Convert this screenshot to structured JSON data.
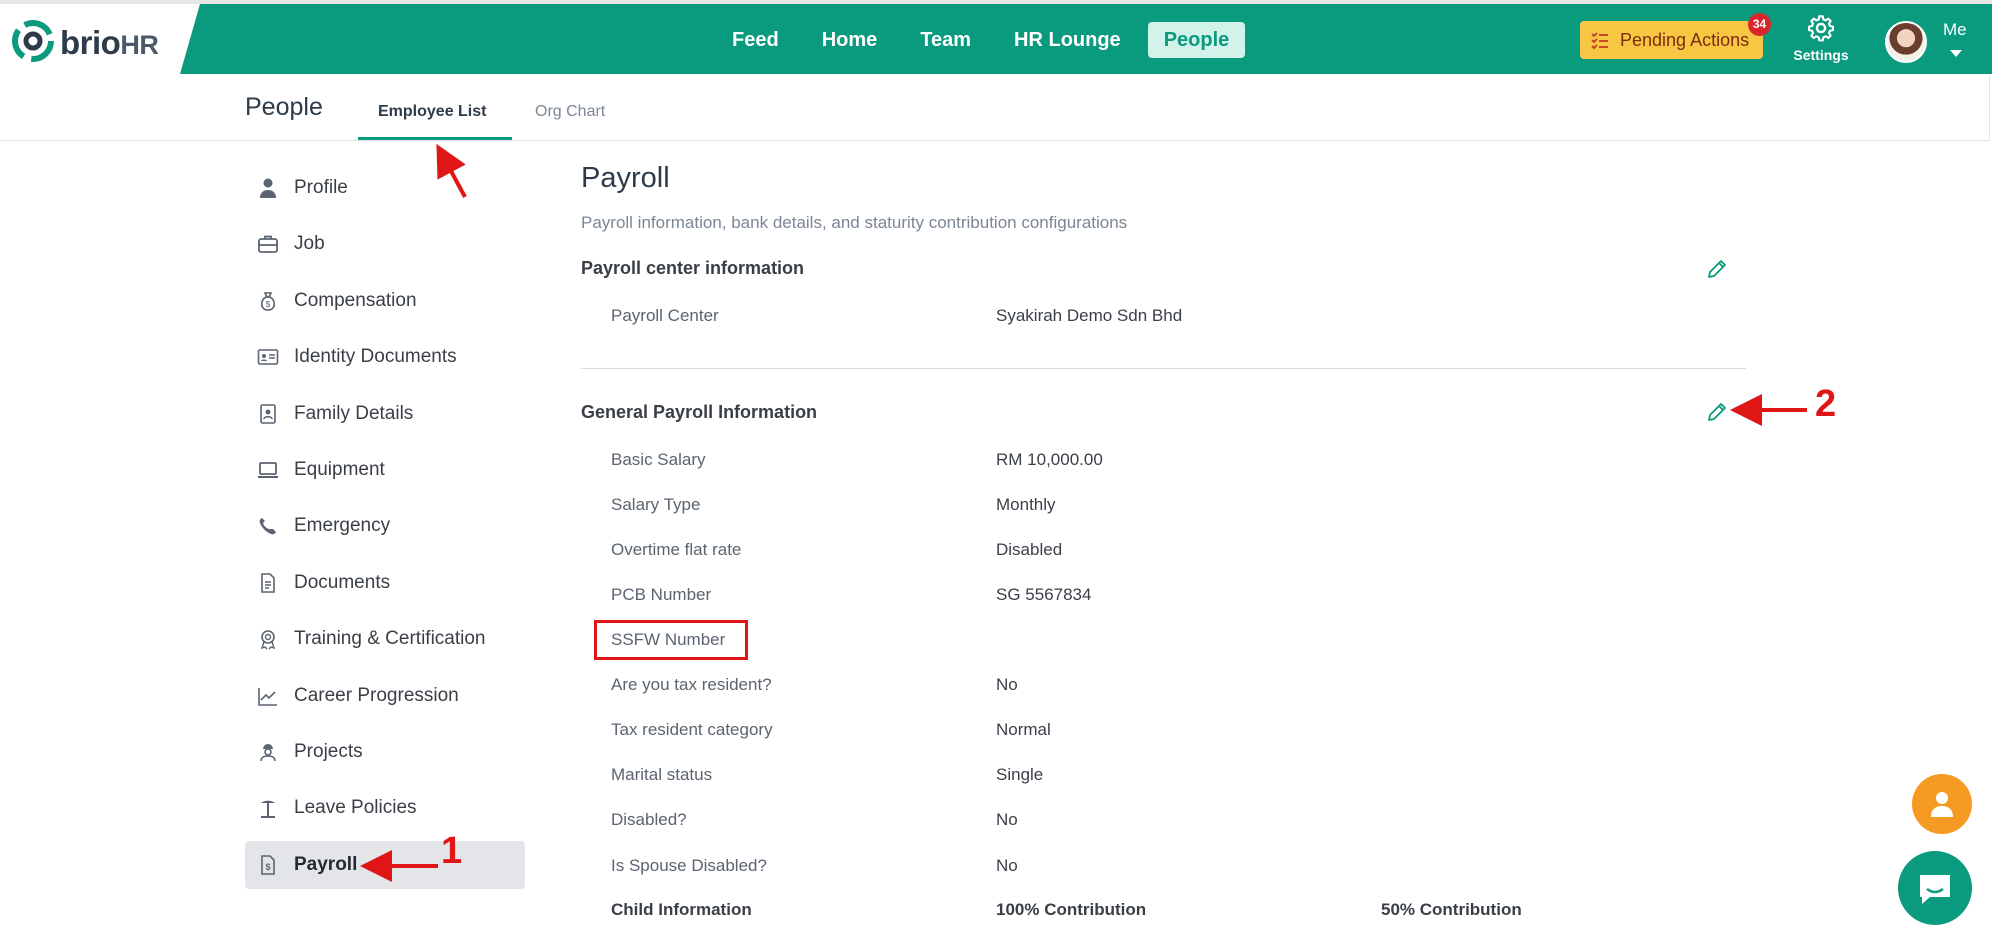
{
  "brand": {
    "name": "brio",
    "suffix": "HR"
  },
  "nav": {
    "items": [
      {
        "label": "Feed"
      },
      {
        "label": "Home"
      },
      {
        "label": "Team"
      },
      {
        "label": "HR Lounge"
      },
      {
        "label": "People",
        "active": true
      }
    ]
  },
  "header": {
    "pending_label": "Pending Actions",
    "pending_count": "34",
    "settings_label": "Settings",
    "user_label": "Me"
  },
  "subheader": {
    "title": "People",
    "tabs": [
      {
        "label": "Employee List",
        "active": true
      },
      {
        "label": "Org Chart"
      }
    ]
  },
  "sidebar": {
    "items": [
      {
        "label": "Profile",
        "icon": "person-icon"
      },
      {
        "label": "Job",
        "icon": "briefcase-icon"
      },
      {
        "label": "Compensation",
        "icon": "money-bag-icon"
      },
      {
        "label": "Identity Documents",
        "icon": "id-card-icon"
      },
      {
        "label": "Family Details",
        "icon": "family-icon"
      },
      {
        "label": "Equipment",
        "icon": "laptop-icon"
      },
      {
        "label": "Emergency",
        "icon": "phone-icon"
      },
      {
        "label": "Documents",
        "icon": "document-icon"
      },
      {
        "label": "Training & Certification",
        "icon": "award-icon"
      },
      {
        "label": "Career Progression",
        "icon": "chart-line-icon"
      },
      {
        "label": "Projects",
        "icon": "worker-icon"
      },
      {
        "label": "Leave Policies",
        "icon": "beach-icon"
      },
      {
        "label": "Payroll",
        "icon": "payroll-icon",
        "active": true
      }
    ]
  },
  "main": {
    "title": "Payroll",
    "subtitle": "Payroll information, bank details, and staturity contribution configurations",
    "payroll_center": {
      "title": "Payroll center information",
      "rows": [
        {
          "label": "Payroll Center",
          "value": "Syakirah Demo Sdn Bhd"
        }
      ]
    },
    "general": {
      "title": "General Payroll Information",
      "rows": [
        {
          "label": "Basic Salary",
          "value": "RM 10,000.00"
        },
        {
          "label": "Salary Type",
          "value": "Monthly"
        },
        {
          "label": "Overtime flat rate",
          "value": "Disabled"
        },
        {
          "label": "PCB Number",
          "value": "SG 5567834"
        },
        {
          "label": "SSFW Number",
          "value": ""
        },
        {
          "label": "Are you tax resident?",
          "value": "No"
        },
        {
          "label": "Tax resident category",
          "value": "Normal"
        },
        {
          "label": "Marital status",
          "value": "Single"
        },
        {
          "label": "Disabled?",
          "value": "No"
        },
        {
          "label": "Is Spouse Disabled?",
          "value": "No"
        }
      ],
      "child_header": {
        "label": "Child Information",
        "col2": "100% Contribution",
        "col3": "50% Contribution"
      }
    }
  },
  "annotations": {
    "one": "1",
    "two": "2"
  },
  "colors": {
    "brand": "#0a9a7e",
    "pending": "#f7c744",
    "annotation": "#e01515",
    "fab_user": "#f59a23"
  }
}
